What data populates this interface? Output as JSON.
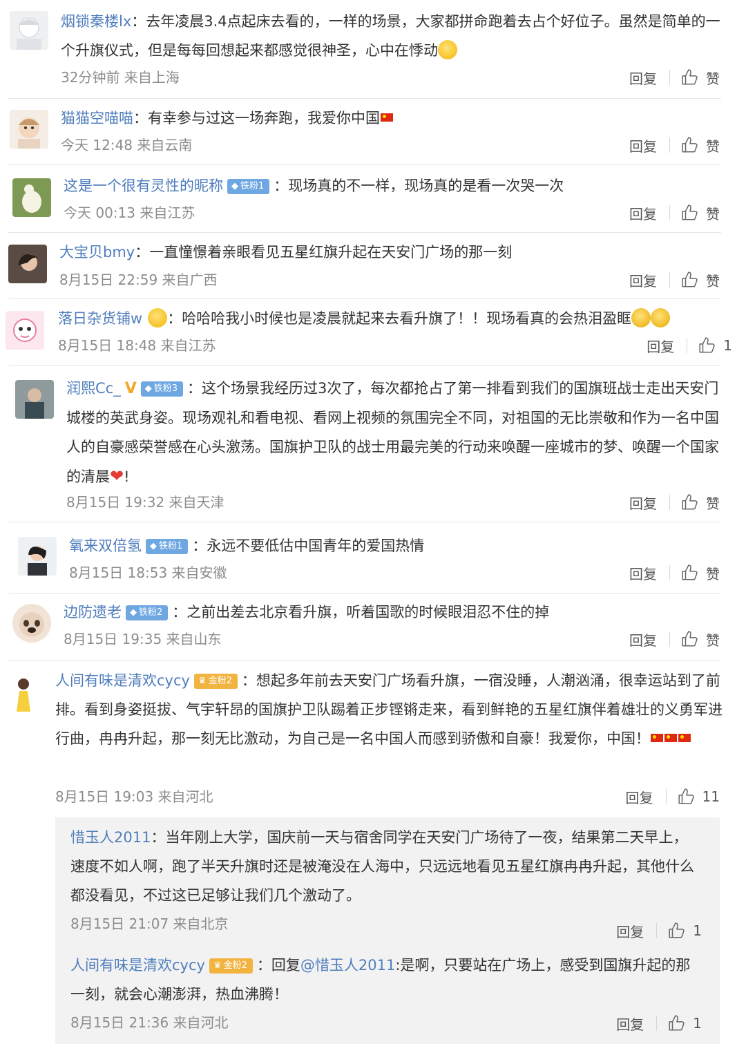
{
  "comments": [
    {
      "username": "烟锁秦楼lx",
      "text": "去年凌晨3.4点起床去看的，一样的场景，大家都拼命跑着去占个好位子。虽然是简单的一个升旗仪式，但是每每回想起来都感觉很神圣，心中在悸动",
      "time": "32分钟前 来自上海",
      "reply": "回复",
      "like": "赞"
    },
    {
      "username": "猫猫空喵喵",
      "text": "有幸参与过这一场奔跑，我爱你中国",
      "time": "今天 12:48 来自云南",
      "reply": "回复",
      "like": "赞"
    },
    {
      "username": "这是一个很有灵性的昵称",
      "badge": "铁粉1",
      "text": "现场真的不一样，现场真的是看一次哭一次",
      "time": "今天 00:13 来自江苏",
      "reply": "回复",
      "like": "赞"
    },
    {
      "username": "大宝贝bmy",
      "text": "一直憧憬着亲眼看见五星红旗升起在天安门广场的那一刻",
      "time": "8月15日 22:59 来自广西",
      "reply": "回复",
      "like": "赞"
    },
    {
      "username": "落日杂货铺w",
      "text": "哈哈哈我小时候也是凌晨就起来去看升旗了！！现场看真的会热泪盈眶",
      "time": "8月15日 18:48 来自江苏",
      "reply": "回复",
      "like": "1"
    },
    {
      "username": "润熙Cc_",
      "verified": "V",
      "badge": "铁粉3",
      "text": "这个场景我经历过3次了，每次都抢占了第一排看到我们的国旗班战士走出天安门城楼的英武身姿。现场观礼和看电视、看网上视频的氛围完全不同，对祖国的无比崇敬和作为一名中国人的自豪感荣誉感在心头激荡。国旗护卫队的战士用最完美的行动来唤醒一座城市的梦、唤醒一个国家的清晨",
      "text_end": "!",
      "time": "8月15日 19:32 来自天津",
      "reply": "回复",
      "like": "赞"
    },
    {
      "username": "氧来双倍氢",
      "badge": "铁粉1",
      "text": "永远不要低估中国青年的爱国热情",
      "time": "8月15日 18:53 来自安徽",
      "reply": "回复",
      "like": "赞"
    },
    {
      "username": "边防遗老",
      "badge": "铁粉2",
      "text": "之前出差去北京看升旗，听着国歌的时候眼泪忍不住的掉",
      "time": "8月15日 19:35 来自山东",
      "reply": "回复",
      "like": "赞"
    },
    {
      "username": "人间有味是清欢cycy",
      "badge": "金粉2",
      "text": "想起多年前去天安门广场看升旗，一宿没睡，人潮汹涌，很幸运站到了前排。看到身姿挺拔、气宇轩昂的国旗护卫队踢着正步铿锵走来，看到鲜艳的五星红旗伴着雄壮的义勇军进行曲，冉冉升起，那一刻无比激动，为自己是一名中国人而感到骄傲和自豪！我爱你，中国！",
      "time": "8月15日 19:03 来自河北",
      "reply": "回复",
      "like": "11"
    }
  ],
  "replies": [
    {
      "username": "惜玉人2011",
      "text": "当年刚上大学，国庆前一天与宿舍同学在天安门广场待了一夜，结果第二天早上，速度不如人啊，跑了半天升旗时还是被淹没在人海中，只远远地看见五星红旗冉冉升起，其他什么都没看见，不过这已足够让我们几个激动了。",
      "time": "8月15日 21:07 来自北京",
      "reply": "回复",
      "like": "1"
    },
    {
      "username": "人间有味是清欢cycy",
      "badge": "金粉2",
      "prefix": "回复",
      "mention": "@惜玉人2011",
      "text": ":是啊，只要站在广场上，感受到国旗升起的那一刻，就会心潮澎湃，热血沸腾！",
      "time": "8月15日 21:36 来自河北",
      "reply": "回复",
      "like": "1"
    }
  ],
  "colors": {
    "username": "#4f7ebd",
    "meta": "#8c8c8c",
    "badge_fan": "#6fa7e3",
    "badge_gold": "#f2b440",
    "flag": "#de2910"
  }
}
